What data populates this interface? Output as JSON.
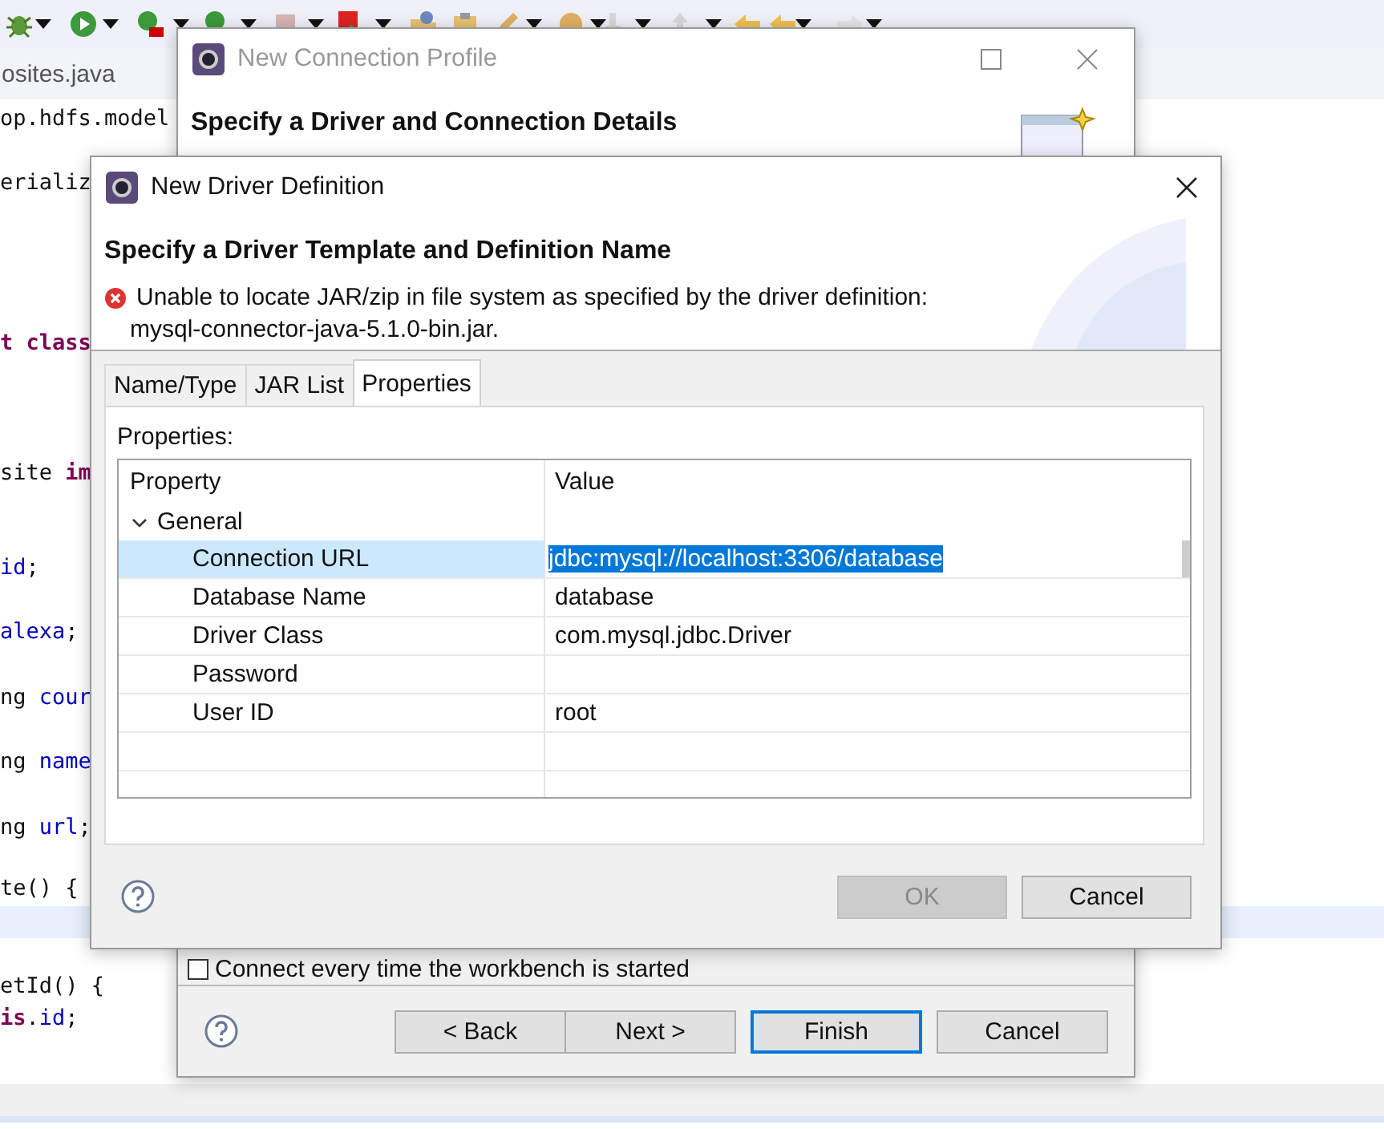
{
  "editor": {
    "tab": "osites.java",
    "lines": [
      [
        {
          "text": "op.hdfs.model",
          "kind": "plain"
        }
      ],
      [
        {
          "text": "erializ",
          "kind": "plain"
        }
      ],
      [
        {
          "text": "t class",
          "kind": "keyword"
        }
      ],
      [
        {
          "text": "site ",
          "kind": "plain"
        },
        {
          "text": "im",
          "kind": "keyword"
        }
      ],
      [
        {
          "text": "id",
          "kind": "field"
        },
        {
          "text": ";",
          "kind": "plain"
        }
      ],
      [
        {
          "text": "alexa",
          "kind": "field"
        },
        {
          "text": ";",
          "kind": "plain"
        }
      ],
      [
        {
          "text": "ng ",
          "kind": "plain"
        },
        {
          "text": "cour",
          "kind": "field"
        }
      ],
      [
        {
          "text": "ng ",
          "kind": "plain"
        },
        {
          "text": "name",
          "kind": "field"
        }
      ],
      [
        {
          "text": "ng ",
          "kind": "plain"
        },
        {
          "text": "url",
          "kind": "field"
        },
        {
          "text": ";",
          "kind": "plain"
        }
      ],
      [
        {
          "text": "te() {",
          "kind": "plain"
        }
      ],
      [
        {
          "text": "etId() {",
          "kind": "plain"
        }
      ],
      [
        {
          "text": "is",
          "kind": "keyword"
        },
        {
          "text": ".",
          "kind": "plain"
        },
        {
          "text": "id",
          "kind": "field"
        },
        {
          "text": ";",
          "kind": "plain"
        }
      ]
    ]
  },
  "profile_dialog": {
    "title": "New Connection Profile",
    "heading": "Specify a Driver and Connection Details",
    "checkbox": {
      "label": "Connect every time the workbench is started",
      "checked": false
    },
    "buttons": [
      {
        "label": "< Back",
        "default": false
      },
      {
        "label": "Next >",
        "default": false
      },
      {
        "label": "Finish",
        "default": true
      },
      {
        "label": "Cancel",
        "default": false
      }
    ]
  },
  "driver_dialog": {
    "title": "New Driver Definition",
    "heading": "Specify a Driver Template and Definition Name",
    "error_lines": [
      "Unable to locate JAR/zip in file system as specified by the driver definition:",
      "mysql-connector-java-5.1.0-bin.jar."
    ],
    "tabs": [
      {
        "label": "Name/Type",
        "selected": false
      },
      {
        "label": "JAR List",
        "selected": false
      },
      {
        "label": "Properties",
        "selected": true
      }
    ],
    "properties_label": "Properties:",
    "table": {
      "columns": [
        "Property",
        "Value"
      ],
      "group": {
        "label": "General",
        "expanded": true
      },
      "rows": [
        {
          "property": "Connection URL",
          "value": "jdbc:mysql://localhost:3306/database",
          "selected": true
        },
        {
          "property": "Database Name",
          "value": "database",
          "selected": false
        },
        {
          "property": "Driver Class",
          "value": "com.mysql.jdbc.Driver",
          "selected": false
        },
        {
          "property": "Password",
          "selected": false
        },
        {
          "property": "User ID",
          "value": "root",
          "selected": false
        }
      ]
    },
    "buttons": [
      {
        "label": "OK",
        "disabled": true
      },
      {
        "label": "Cancel",
        "disabled": false
      }
    ]
  }
}
